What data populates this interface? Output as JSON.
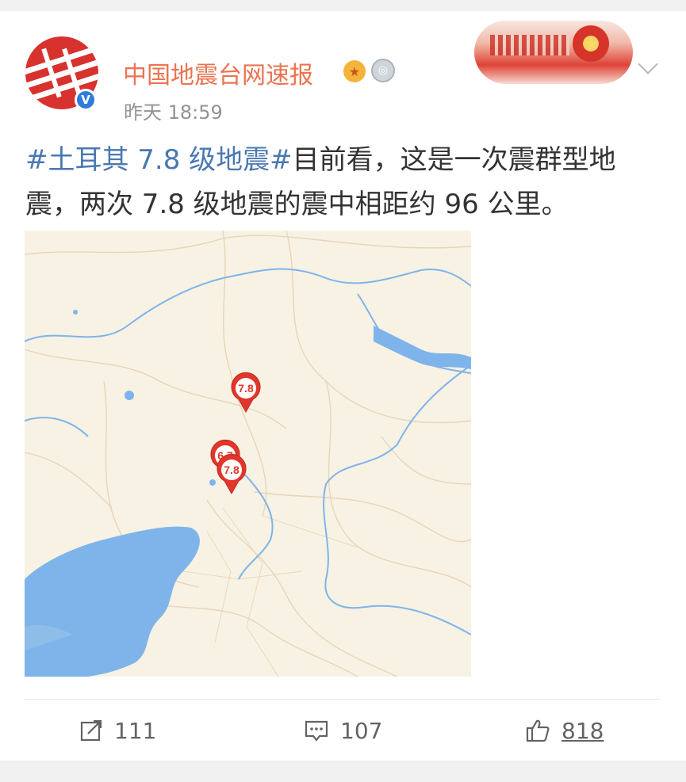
{
  "user": {
    "name": "中国地震台网速报",
    "time": "昨天 18:59",
    "verified_mark": "V"
  },
  "post": {
    "hashtag": "#土耳其 7.8 级地震#",
    "text": "目前看，这是一次震群型地震，两次 7.8 级地震的震中相距约 96 公里。"
  },
  "map": {
    "markers": [
      {
        "label": "7.8"
      },
      {
        "label": "6.7"
      },
      {
        "label": "7.8"
      }
    ]
  },
  "actions": {
    "reposts": "111",
    "comments": "107",
    "likes": "818"
  },
  "icons": {
    "avatar": "agency-logo-icon",
    "badge1": "medal-icon",
    "badge2": "silver-badge-icon",
    "menu": "chevron-down-icon",
    "repost": "share-icon",
    "comment": "comment-icon",
    "like": "thumbs-up-icon"
  },
  "colors": {
    "username": "#eb7350",
    "hashtag": "#4a78b2",
    "marker": "#e0362b",
    "water": "#7fb4ea",
    "land": "#f7f2e4"
  }
}
